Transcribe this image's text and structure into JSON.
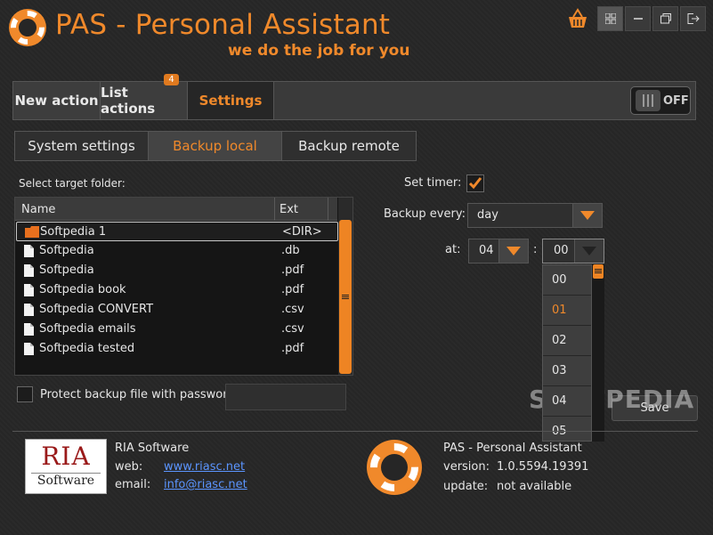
{
  "app": {
    "title": "PAS - Personal Assistant",
    "subtitle": "we do the job for you",
    "accent_color": "#f0892b"
  },
  "window_controls": {
    "basket_icon": "basket-icon",
    "buttons": [
      "grid-icon",
      "minimize-icon",
      "restore-icon",
      "exit-icon"
    ]
  },
  "nav": {
    "new_action": "New action",
    "list_actions": "List actions",
    "list_actions_badge": "4",
    "settings": "Settings",
    "toggle_label": "OFF"
  },
  "tabs": {
    "system": "System settings",
    "backup_local": "Backup local",
    "backup_remote": "Backup remote"
  },
  "folder": {
    "label": "Select target folder:",
    "columns": {
      "name": "Name",
      "ext": "Ext"
    },
    "rows": [
      {
        "name": "Softpedia 1",
        "ext": "<DIR>",
        "icon": "folder-icon"
      },
      {
        "name": "Softpedia",
        "ext": ".db",
        "icon": "file-icon"
      },
      {
        "name": "Softpedia",
        "ext": ".pdf",
        "icon": "file-icon"
      },
      {
        "name": "Softpedia book",
        "ext": ".pdf",
        "icon": "file-icon"
      },
      {
        "name": "Softpedia CONVERT",
        "ext": ".csv",
        "icon": "file-icon"
      },
      {
        "name": "Softpedia emails",
        "ext": ".csv",
        "icon": "file-icon"
      },
      {
        "name": "Softpedia tested",
        "ext": ".pdf",
        "icon": "file-icon"
      }
    ]
  },
  "protect": {
    "label": "Protect backup file with password:",
    "checked": false,
    "value": ""
  },
  "timer": {
    "set_timer_label": "Set timer:",
    "checked": true,
    "backup_every_label": "Backup every:",
    "backup_every_value": "day",
    "at_label": "at:",
    "hour_value": "04",
    "colon": ":",
    "minute_value": "00",
    "minute_options": [
      "00",
      "01",
      "02",
      "03",
      "04",
      "05"
    ],
    "highlighted_option": "01"
  },
  "save_label": "Save",
  "footer": {
    "company": "RIA Software",
    "web_label": "web:",
    "web_value": "www.riasc.net",
    "email_label": "email:",
    "email_value": "info@riasc.net",
    "logo_top": "RIA",
    "logo_bottom": "Software",
    "product": "PAS - Personal Assistant",
    "version_label": "version:",
    "version_value": "1.0.5594.19391",
    "update_label": "update:",
    "update_value": "not available"
  },
  "watermark": "SOFTPEDIA"
}
